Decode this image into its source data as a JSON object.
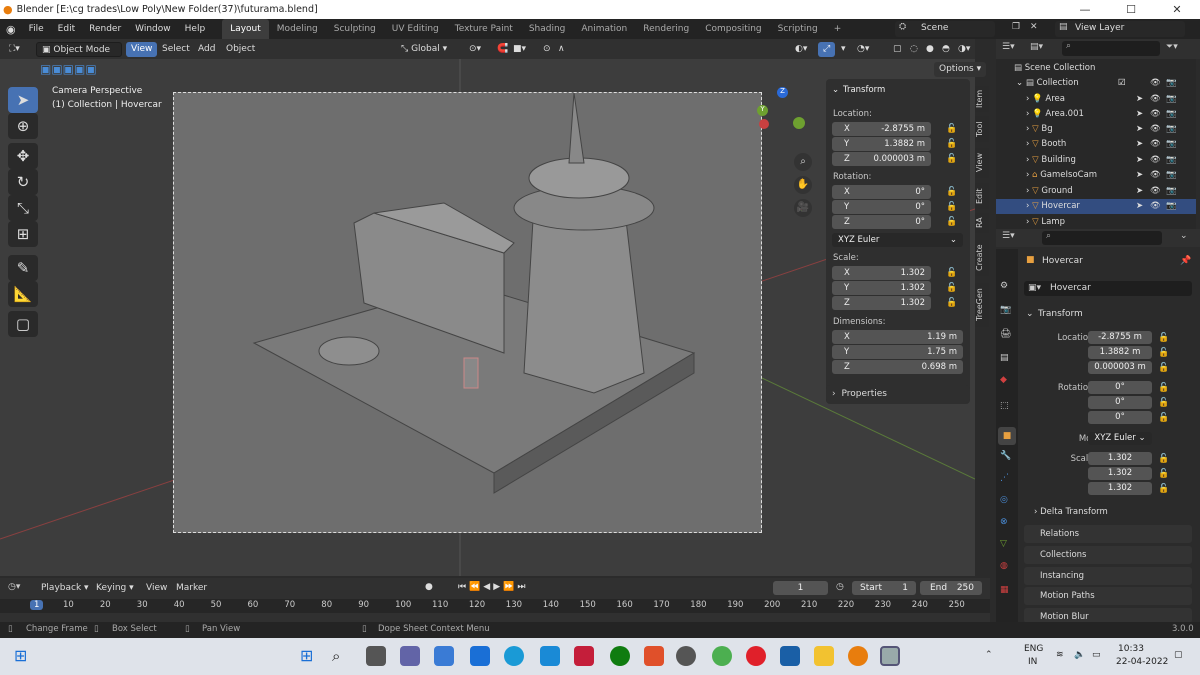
{
  "window": {
    "title": "Blender [E:\\cg trades\\Low Poly\\New Folder(37)\\futurama.blend]",
    "minimize": "—",
    "maximize": "☐",
    "close": "✕"
  },
  "menus": [
    "File",
    "Edit",
    "Render",
    "Window",
    "Help"
  ],
  "workspaces": [
    "Layout",
    "Modeling",
    "Sculpting",
    "UV Editing",
    "Texture Paint",
    "Shading",
    "Animation",
    "Rendering",
    "Compositing",
    "Scripting"
  ],
  "scene": "Scene",
  "view_layer": "View Layer",
  "header": {
    "mode": "Object Mode",
    "view": "View",
    "select": "Select",
    "add": "Add",
    "object": "Object",
    "orientation": "Global",
    "options": "Options"
  },
  "viewport": {
    "camera_label": "Camera Perspective",
    "collection_label": "(1) Collection | Hovercar"
  },
  "n_panel": {
    "title": "Transform",
    "location_label": "Location:",
    "loc_x": "-2.8755 m",
    "loc_y": "1.3882 m",
    "loc_z": "0.000003 m",
    "rotation_label": "Rotation:",
    "rot_x": "0°",
    "rot_y": "0°",
    "rot_z": "0°",
    "rotation_mode": "XYZ Euler",
    "scale_label": "Scale:",
    "scale_x": "1.302",
    "scale_y": "1.302",
    "scale_z": "1.302",
    "dimensions_label": "Dimensions:",
    "dim_x": "1.19 m",
    "dim_y": "1.75 m",
    "dim_z": "0.698 m",
    "properties_label": "Properties",
    "axis_x": "X",
    "axis_y": "Y",
    "axis_z": "Z"
  },
  "side_tabs": [
    "Item",
    "Tool",
    "View",
    "Edit",
    "RA",
    "Create",
    "TreeGen"
  ],
  "outliner": {
    "root": "Scene Collection",
    "collection": "Collection",
    "items": [
      "Area",
      "Area.001",
      "Bg",
      "Booth",
      "Building",
      "GameIsoCam",
      "Ground",
      "Hovercar",
      "Lamp"
    ]
  },
  "properties": {
    "object_name": "Hovercar",
    "data_name": "Hovercar",
    "transform": "Transform",
    "location_x_label": "Location X",
    "y_label": "Y",
    "z_label": "Z",
    "loc_x": "-2.8755 m",
    "loc_y": "1.3882 m",
    "loc_z": "0.000003 m",
    "rotation_x_label": "Rotation X",
    "rot_x": "0°",
    "rot_y": "0°",
    "rot_z": "0°",
    "mode_label": "Mode",
    "mode": "XYZ Euler",
    "scale_x_label": "Scale X",
    "scale_x": "1.302",
    "scale_y": "1.302",
    "scale_z": "1.302",
    "delta": "Delta Transform",
    "sections": [
      "Relations",
      "Collections",
      "Instancing",
      "Motion Paths",
      "Motion Blur"
    ]
  },
  "timeline": {
    "playback": "Playback",
    "keying": "Keying",
    "view": "View",
    "marker": "Marker",
    "current_frame": "1",
    "start_label": "Start",
    "start": "1",
    "end_label": "End",
    "end": "250",
    "ticks": [
      "1",
      "10",
      "20",
      "30",
      "40",
      "50",
      "60",
      "70",
      "80",
      "90",
      "100",
      "110",
      "120",
      "130",
      "140",
      "150",
      "160",
      "170",
      "180",
      "190",
      "200",
      "210",
      "220",
      "230",
      "240",
      "250"
    ]
  },
  "status": {
    "change_frame": "Change Frame",
    "box_select": "Box Select",
    "pan_view": "Pan View",
    "context_menu": "Dope Sheet Context Menu",
    "version": "3.0.0"
  },
  "taskbar": {
    "lang": "ENG",
    "region": "IN",
    "time": "10:33",
    "date": "22-04-2022"
  }
}
